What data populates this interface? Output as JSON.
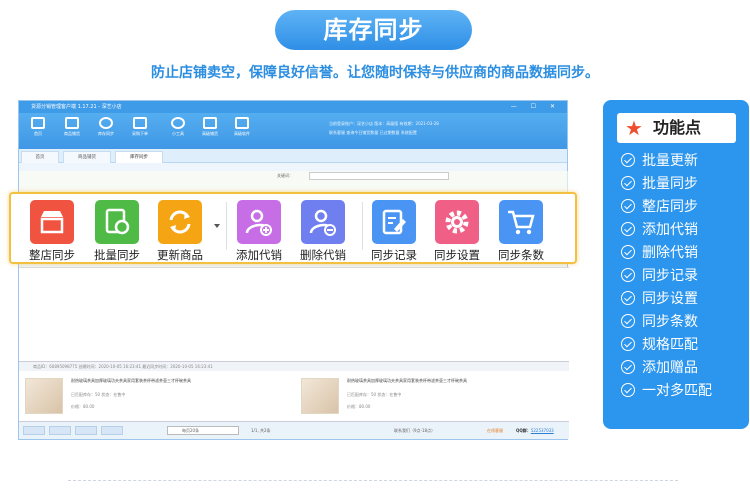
{
  "header": {
    "title": "库存同步",
    "subtitle": "防止店铺卖空，保障良好信誉。让您随时保持与供应商的商品数据同步。"
  },
  "app": {
    "window_title": "货源分销管理客户端 1.17.21 - 深艺小店",
    "window_controls": "— ☐ ✕",
    "ribbon_items": [
      "首页",
      "商品铺货",
      "库存同步",
      "采购下单",
      "小工具",
      "高级铺货",
      "高级软件"
    ],
    "ribbon_info": [
      "当前登录账户：深艺小店  版本：高级版  有效期：2021-03-28",
      "联系客服   查询今日铺货数量   已过期数量   系统配置"
    ],
    "tabs": [
      "首页",
      "商品铺货",
      "库存同步"
    ],
    "search_label": "关键词：",
    "product_header": "商品ID：60895098775     创建时间：2020-10-05 16:23:41     最近同步时间：2020-10-05 16:23:41",
    "products": [
      {
        "title": "耐热玻璃茶具加厚玻璃功夫茶具家用套装茶杯带滤茶壶三才杯碗茶具",
        "meta": "已匹配库存：50     状态：在售中",
        "price": "价格：80.00"
      },
      {
        "title": "耐热玻璃茶具加厚玻璃功夫茶具家用套装茶杯带滤茶壶三才杯碗茶具",
        "meta": "已匹配库存：50     状态：在售中",
        "price": "价格：80.00"
      }
    ],
    "pager": {
      "buttons": [
        "首页",
        "上一页",
        "下一页",
        "尾页"
      ],
      "page_size": "每页20条",
      "page_info": "1/1, 共2条",
      "selected": "联系我们（9点-18点）",
      "service": "在线客服",
      "qq_label": "QQ群：",
      "qq": "522537033"
    }
  },
  "toolbar": {
    "items": [
      {
        "label": "整店同步",
        "icon": "store-icon",
        "color": "#f0533f"
      },
      {
        "label": "批量同步",
        "icon": "batch-sync-icon",
        "color": "#4fba45"
      },
      {
        "label": "更新商品",
        "icon": "refresh-icon",
        "color": "#f5a413"
      },
      {
        "label": "添加代销",
        "icon": "add-user-icon",
        "color": "#c76ee6"
      },
      {
        "label": "删除代销",
        "icon": "remove-user-icon",
        "color": "#6f7ff0"
      },
      {
        "label": "同步记录",
        "icon": "edit-record-icon",
        "color": "#4a95f3"
      },
      {
        "label": "同步设置",
        "icon": "gear-icon",
        "color": "#ef5f86"
      },
      {
        "label": "同步条数",
        "icon": "cart-icon",
        "color": "#4a95f3"
      }
    ]
  },
  "panel": {
    "title": "功能点",
    "features": [
      "批量更新",
      "批量同步",
      "整店同步",
      "添加代销",
      "删除代销",
      "同步记录",
      "同步设置",
      "同步条数",
      "规格匹配",
      "添加赠品",
      "一对多匹配"
    ]
  }
}
